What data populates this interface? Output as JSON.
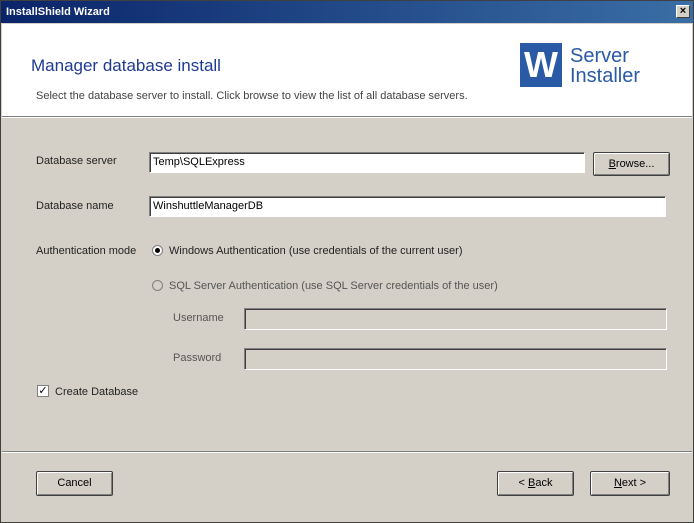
{
  "window": {
    "title": "InstallShield Wizard",
    "close_glyph": "×"
  },
  "header": {
    "heading": "Manager database install",
    "subtext": "Select the database server to install. Click browse to view the list of all database servers.",
    "logo_letter": "W",
    "logo_line1": "Server",
    "logo_line2": "Installer"
  },
  "form": {
    "database_server_label": "Database server",
    "database_server_value": "Temp\\SQLExpress",
    "browse_label_u": "B",
    "browse_label_rest": "rowse...",
    "database_name_label": "Database name",
    "database_name_value": "WinshuttleManagerDB",
    "auth_mode_label": "Authentication mode",
    "auth_windows_label": "Windows Authentication (use credentials of the current user)",
    "auth_sql_label": "SQL Server Authentication (use SQL Server credentials of the user)",
    "username_label": "Username",
    "username_value": "",
    "password_label": "Password",
    "password_value": "",
    "create_db_label": "Create Database",
    "create_db_checked": true,
    "selected_auth": "windows"
  },
  "footer": {
    "cancel_label": "Cancel",
    "back_prefix": "< ",
    "back_u": "B",
    "back_rest": "ack",
    "next_u": "N",
    "next_rest": "ext >"
  },
  "colors": {
    "title_bar": "#0a246a",
    "heading": "#1f3a93",
    "logo": "#2a5aa6"
  }
}
